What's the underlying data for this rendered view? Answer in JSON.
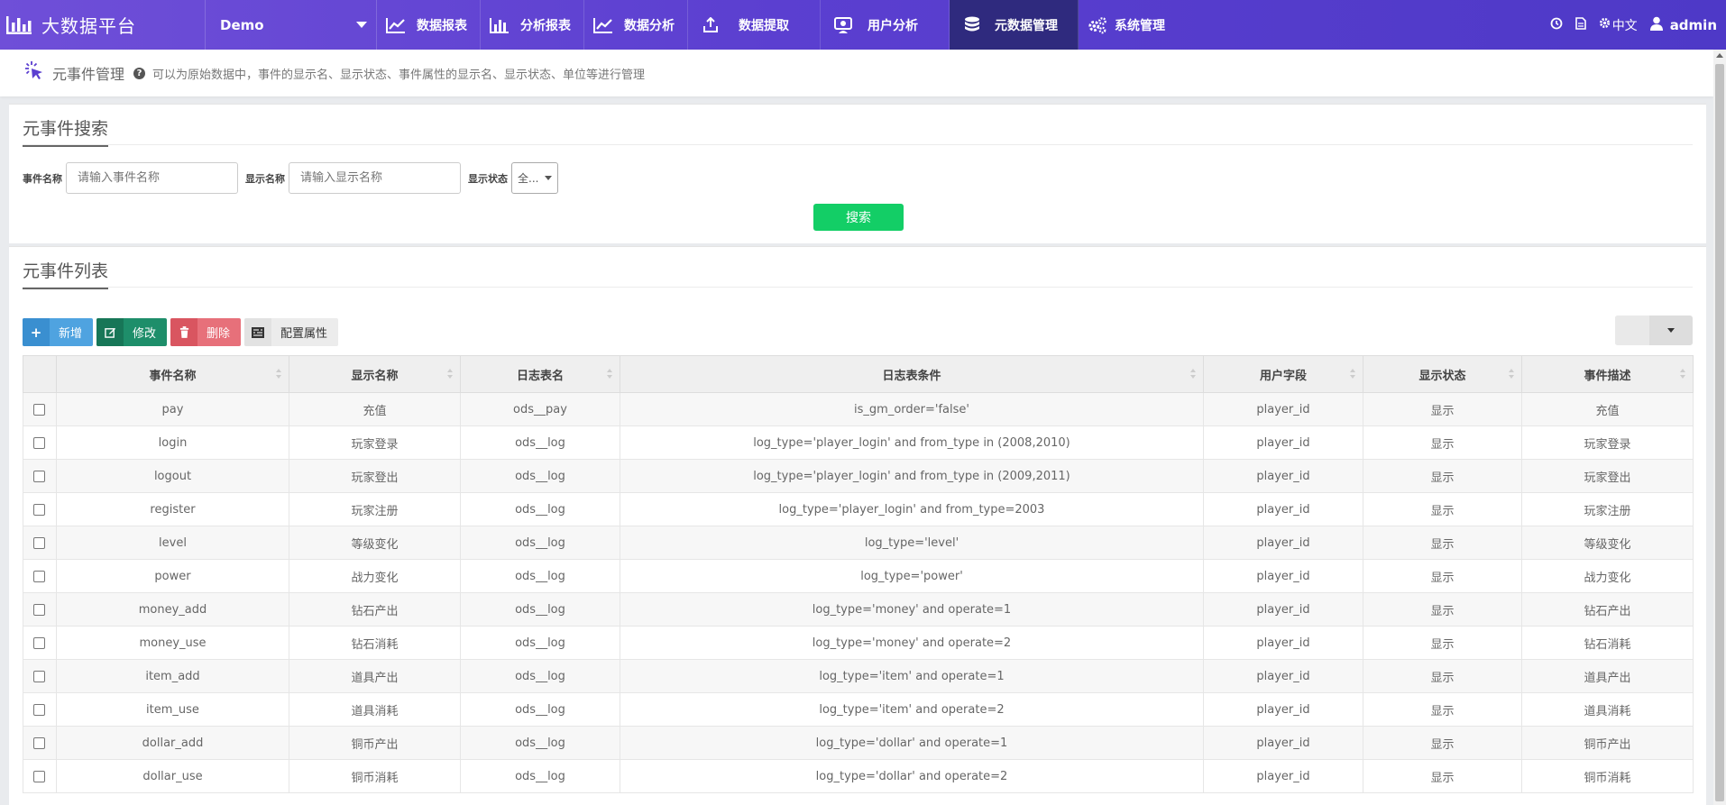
{
  "navbar": {
    "brand": "大数据平台",
    "project": "Demo",
    "items": [
      {
        "label": "数据报表",
        "icon": "line-chart-icon",
        "active": false
      },
      {
        "label": "分析报表",
        "icon": "bar-chart-icon",
        "active": false
      },
      {
        "label": "数据分析",
        "icon": "line-chart-icon",
        "active": false
      },
      {
        "label": "数据提取",
        "icon": "upload-icon",
        "active": false
      },
      {
        "label": "用户分析",
        "icon": "user-analysis-icon",
        "active": false
      },
      {
        "label": "元数据管理",
        "icon": "database-icon",
        "active": true
      },
      {
        "label": "系统管理",
        "icon": "gears-icon",
        "active": false
      }
    ],
    "language": "中文",
    "user": "admin"
  },
  "page_header": {
    "title": "元事件管理",
    "description": "可以为原始数据中，事件的显示名、显示状态、事件属性的显示名、显示状态、单位等进行管理"
  },
  "search": {
    "title": "元事件搜索",
    "event_name_label": "事件名称",
    "event_name_placeholder": "请输入事件名称",
    "display_name_label": "显示名称",
    "display_name_placeholder": "请输入显示名称",
    "status_label": "显示状态",
    "status_value": "全...",
    "button": "搜索"
  },
  "list": {
    "title": "元事件列表",
    "toolbar": {
      "add": "新增",
      "edit": "修改",
      "delete": "删除",
      "config": "配置属性"
    },
    "columns": [
      "事件名称",
      "显示名称",
      "日志表名",
      "日志表条件",
      "用户字段",
      "显示状态",
      "事件描述"
    ],
    "rows": [
      [
        "pay",
        "充值",
        "ods__pay",
        "is_gm_order='false'",
        "player_id",
        "显示",
        "充值"
      ],
      [
        "login",
        "玩家登录",
        "ods__log",
        "log_type='player_login' and from_type in (2008,2010)",
        "player_id",
        "显示",
        "玩家登录"
      ],
      [
        "logout",
        "玩家登出",
        "ods__log",
        "log_type='player_login' and from_type in (2009,2011)",
        "player_id",
        "显示",
        "玩家登出"
      ],
      [
        "register",
        "玩家注册",
        "ods__log",
        "log_type='player_login' and from_type=2003",
        "player_id",
        "显示",
        "玩家注册"
      ],
      [
        "level",
        "等级变化",
        "ods__log",
        "log_type='level'",
        "player_id",
        "显示",
        "等级变化"
      ],
      [
        "power",
        "战力变化",
        "ods__log",
        "log_type='power'",
        "player_id",
        "显示",
        "战力变化"
      ],
      [
        "money_add",
        "钻石产出",
        "ods__log",
        "log_type='money' and operate=1",
        "player_id",
        "显示",
        "钻石产出"
      ],
      [
        "money_use",
        "钻石消耗",
        "ods__log",
        "log_type='money' and operate=2",
        "player_id",
        "显示",
        "钻石消耗"
      ],
      [
        "item_add",
        "道具产出",
        "ods__log",
        "log_type='item' and operate=1",
        "player_id",
        "显示",
        "道具产出"
      ],
      [
        "item_use",
        "道具消耗",
        "ods__log",
        "log_type='item' and operate=2",
        "player_id",
        "显示",
        "道具消耗"
      ],
      [
        "dollar_add",
        "铜币产出",
        "ods__log",
        "log_type='dollar' and operate=1",
        "player_id",
        "显示",
        "铜币产出"
      ],
      [
        "dollar_use",
        "铜币消耗",
        "ods__log",
        "log_type='dollar' and operate=2",
        "player_id",
        "显示",
        "铜币消耗"
      ]
    ]
  },
  "colors": {
    "nav_start": "#6f4fd8",
    "nav_end": "#4e39c7",
    "nav_active": "#2f2a7e",
    "search_button": "#13ce66"
  }
}
